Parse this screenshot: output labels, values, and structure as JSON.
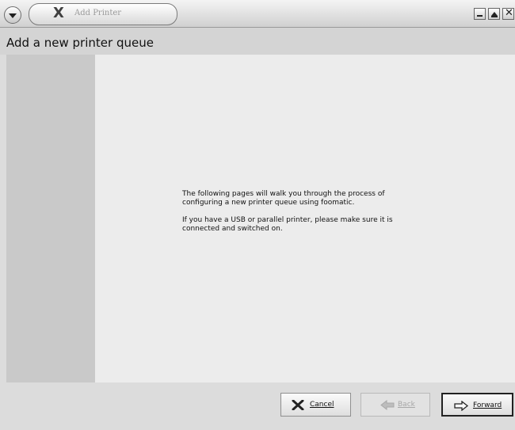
{
  "window": {
    "title": "Add Printer",
    "app_icon": "x-logo-icon",
    "controls": [
      "window-menu-icon",
      "minimize-icon",
      "maximize-icon",
      "close-icon"
    ]
  },
  "header": {
    "title": "Add a new printer queue"
  },
  "content": {
    "paragraph1": "The following pages will walk you through the process of\nconfiguring a new printer queue using foomatic.",
    "paragraph2": "If you have a USB or parallel printer, please make sure it is\nconnected and switched on."
  },
  "footer": {
    "cancel": {
      "label": "Cancel",
      "icon": "cancel-x-icon",
      "enabled": true
    },
    "back": {
      "label": "Back",
      "icon": "back-arrow-icon",
      "enabled": false
    },
    "forward": {
      "label": "Forward",
      "icon": "forward-arrow-icon",
      "enabled": true,
      "default": true
    }
  }
}
